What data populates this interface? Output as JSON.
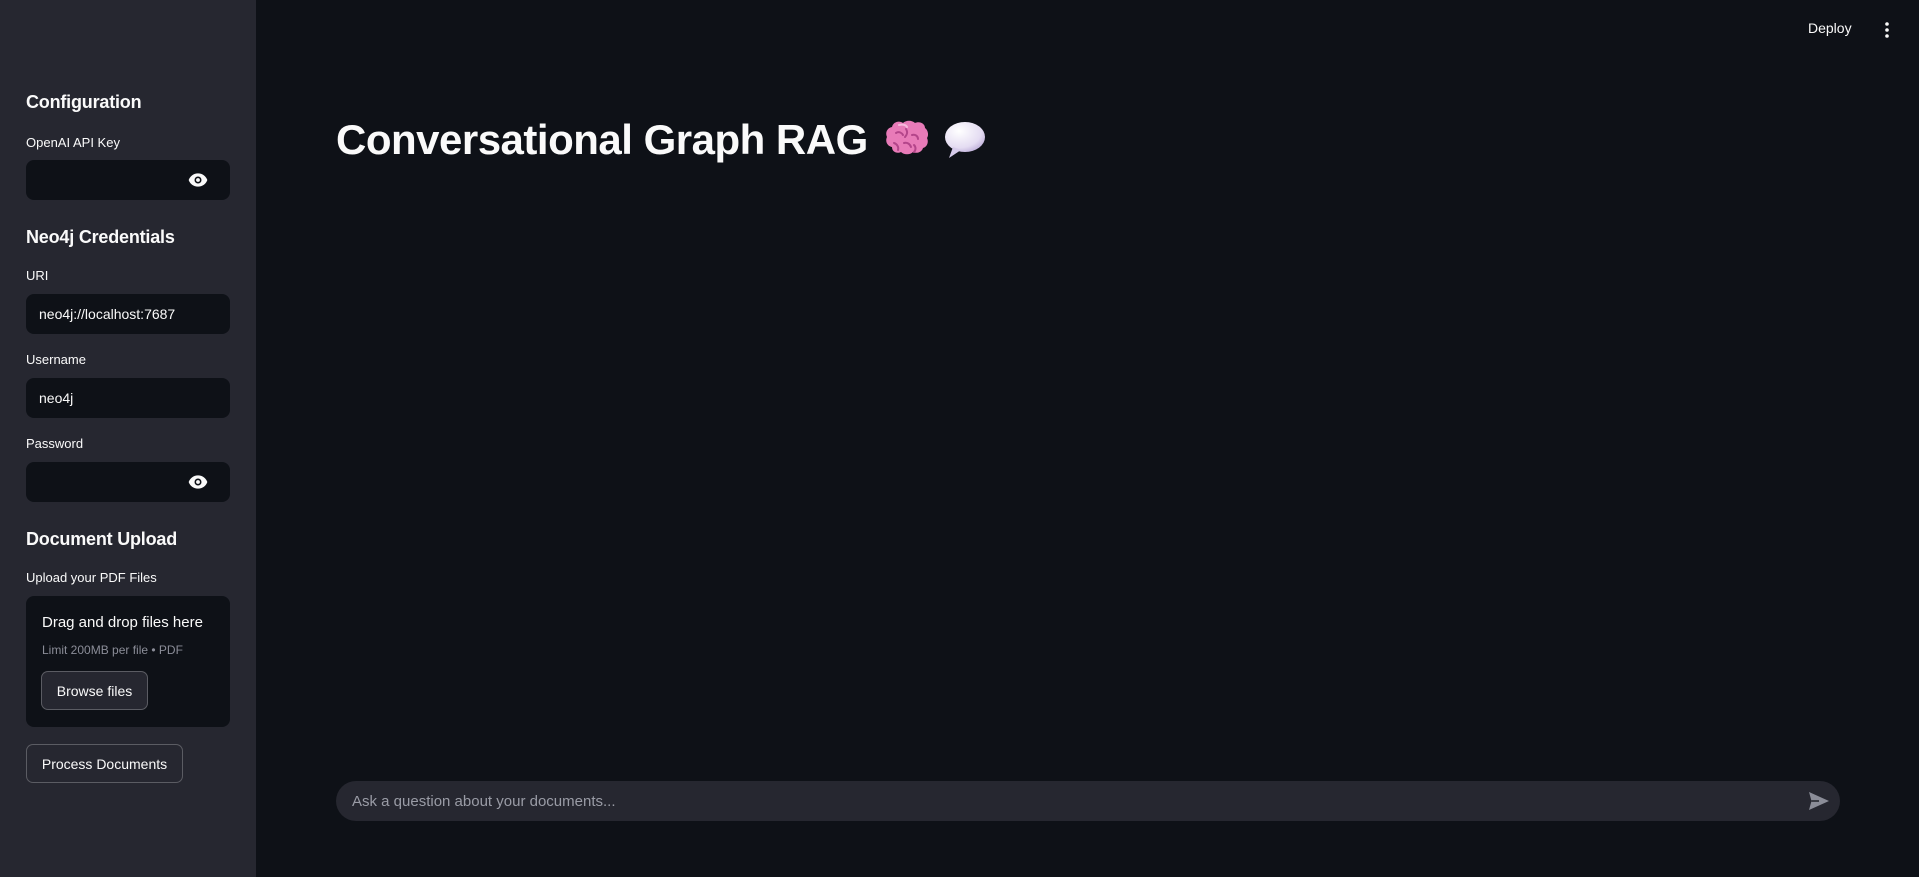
{
  "header": {
    "deploy_label": "Deploy",
    "menu_icon": "more-vertical-icon"
  },
  "sidebar": {
    "configuration_heading": "Configuration",
    "openai_label": "OpenAI API Key",
    "openai_value": "",
    "neo4j_heading": "Neo4j Credentials",
    "uri_label": "URI",
    "uri_value": "neo4j://localhost:7687",
    "username_label": "Username",
    "username_value": "neo4j",
    "password_label": "Password",
    "password_value": "",
    "upload_heading": "Document Upload",
    "upload_label": "Upload your PDF Files",
    "drag_text": "Drag and drop files here",
    "limit_text": "Limit 200MB per file • PDF",
    "browse_label": "Browse files",
    "process_label": "Process Documents"
  },
  "main": {
    "title": "Conversational Graph RAG",
    "title_icons": [
      "brain-emoji-icon",
      "speech-bubble-emoji-icon"
    ]
  },
  "chat": {
    "placeholder": "Ask a question about your documents...",
    "send_icon": "send-icon"
  },
  "colors": {
    "background": "#0e1117",
    "sidebar": "#262730",
    "text": "#fafafa",
    "muted": "#8b8d98"
  }
}
